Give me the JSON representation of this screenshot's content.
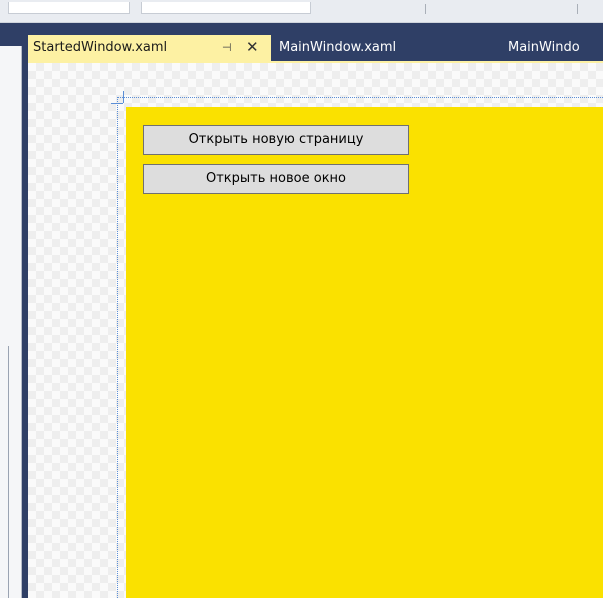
{
  "tabs": [
    {
      "label": "StartedWindow.xaml",
      "active": true
    },
    {
      "label": "MainWindow.xaml",
      "active": false
    },
    {
      "label": "MainWindo",
      "active": false
    }
  ],
  "tab_icons": {
    "pin": "pin-icon",
    "close": "close-icon"
  },
  "designer": {
    "buttons": [
      {
        "label": "Открыть новую страницу"
      },
      {
        "label": "Открыть новое окно"
      }
    ]
  },
  "colors": {
    "tab_strip_bg": "#2f3f66",
    "active_tab_bg": "#fdf1a3",
    "window_surface_bg": "#fae100",
    "button_bg": "#dddddd",
    "guide_line": "#5b8ed6"
  }
}
